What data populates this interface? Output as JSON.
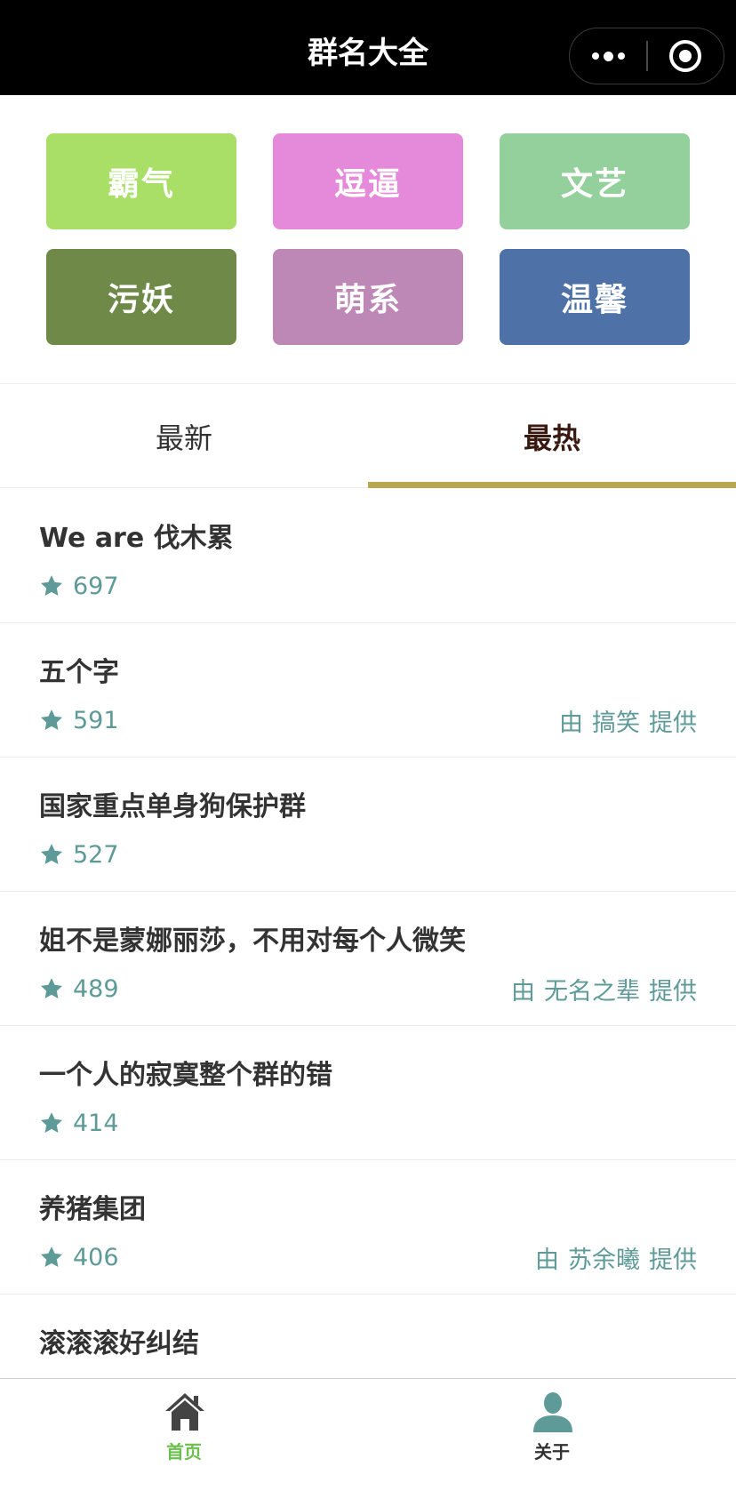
{
  "navbar": {
    "title": "群名大全"
  },
  "categories": [
    {
      "label": "霸气",
      "color": "#a9df66"
    },
    {
      "label": "逗逼",
      "color": "#e58adb"
    },
    {
      "label": "文艺",
      "color": "#93d09b"
    },
    {
      "label": "污妖",
      "color": "#6f8a48"
    },
    {
      "label": "萌系",
      "color": "#bd88b6"
    },
    {
      "label": "温馨",
      "color": "#4e71a8"
    }
  ],
  "tabs": {
    "newest": "最新",
    "hottest": "最热",
    "accent": "#b9a752"
  },
  "list": [
    {
      "name": "We are 伐木累",
      "stars": "697",
      "provider": null
    },
    {
      "name": "五个字",
      "stars": "591",
      "provider": {
        "prefix": "由",
        "who": "搞笑",
        "suffix": "提供"
      }
    },
    {
      "name": "国家重点单身狗保护群",
      "stars": "527",
      "provider": null
    },
    {
      "name": "姐不是蒙娜丽莎，不用对每个人微笑",
      "stars": "489",
      "provider": {
        "prefix": "由",
        "who": "无名之辈",
        "suffix": "提供"
      }
    },
    {
      "name": "一个人的寂寞整个群的错",
      "stars": "414",
      "provider": null
    },
    {
      "name": "养猪集团",
      "stars": "406",
      "provider": {
        "prefix": "由",
        "who": "苏余曦",
        "suffix": "提供"
      }
    },
    {
      "name": "滚滚滚好纠结",
      "stars": "",
      "provider": null
    }
  ],
  "tabbar": {
    "home": {
      "label": "首页",
      "icon": "home-icon",
      "color": "#6bbf4e",
      "icon_color": "#444444"
    },
    "about": {
      "label": "关于",
      "icon": "user-icon",
      "color": "#333333",
      "icon_color": "#5e9a98"
    }
  },
  "colors": {
    "star": "#5e9a98",
    "text": "#333333"
  }
}
